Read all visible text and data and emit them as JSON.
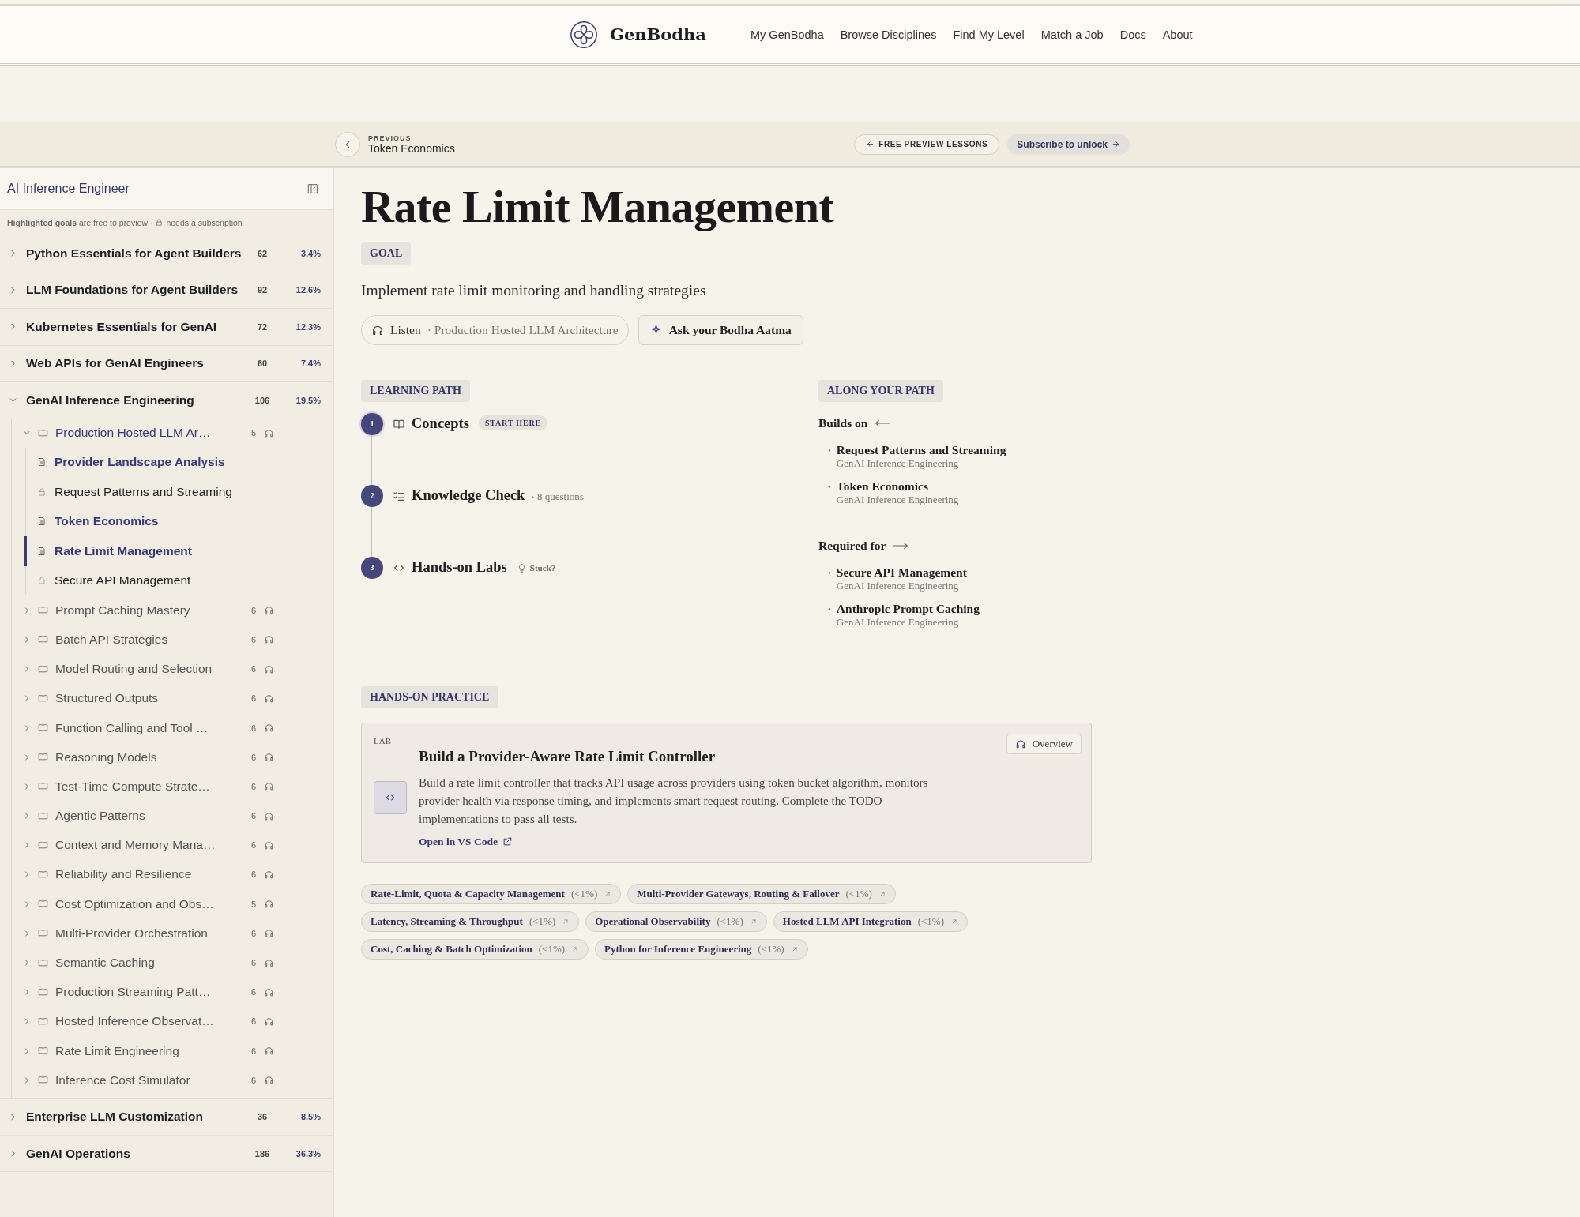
{
  "header": {
    "brand": "GenBodha",
    "nav": [
      {
        "label": "My GenBodha"
      },
      {
        "label": "Browse Disciplines"
      },
      {
        "label": "Find My Level"
      },
      {
        "label": "Match a Job"
      },
      {
        "label": "Docs"
      },
      {
        "label": "About"
      }
    ]
  },
  "nav_bar": {
    "previous_label": "PREVIOUS",
    "previous_title": "Token Economics",
    "preview_button": "FREE PREVIEW LESSONS",
    "subscribe_button": "Subscribe to unlock"
  },
  "sidebar": {
    "title": "AI Inference Engineer",
    "legend": "**Highlighted goals** are free to preview ·",
    "legend_lock": "needs a subscription",
    "modules": [
      {
        "title": "Python Essentials for Agent Builders",
        "count": "62",
        "percent": "3.4%",
        "expanded": false
      },
      {
        "title": "LLM Foundations for Agent Builders",
        "count": "92",
        "percent": "12.6%",
        "expanded": false
      },
      {
        "title": "Kubernetes Essentials for GenAI",
        "count": "72",
        "percent": "12.3%",
        "expanded": false
      },
      {
        "title": "Web APIs for GenAI Engineers",
        "count": "60",
        "percent": "7.4%",
        "expanded": false
      },
      {
        "title": "GenAI Inference Engineering",
        "count": "106",
        "percent": "19.5%",
        "expanded": true,
        "children": [
          {
            "title": "Production Hosted LLM Ar…",
            "count": "5",
            "expanded": true,
            "children": [
              {
                "title": "Provider Landscape Analysis",
                "free": true,
                "selected": false
              },
              {
                "title": "Request Patterns and Streaming",
                "free": false,
                "selected": false
              },
              {
                "title": "Token Economics",
                "free": true,
                "selected": false
              },
              {
                "title": "Rate Limit Management",
                "free": true,
                "selected": true
              },
              {
                "title": "Secure API Management",
                "free": false,
                "selected": false
              }
            ]
          },
          {
            "title": "Prompt Caching Mastery",
            "count": "6",
            "expanded": false
          },
          {
            "title": "Batch API Strategies",
            "count": "6",
            "expanded": false
          },
          {
            "title": "Model Routing and Selection",
            "count": "6",
            "expanded": false
          },
          {
            "title": "Structured Outputs",
            "count": "6",
            "expanded": false
          },
          {
            "title": "Function Calling and Tool …",
            "count": "6",
            "expanded": false
          },
          {
            "title": "Reasoning Models",
            "count": "6",
            "expanded": false
          },
          {
            "title": "Test-Time Compute Strate…",
            "count": "6",
            "expanded": false
          },
          {
            "title": "Agentic Patterns",
            "count": "6",
            "expanded": false
          },
          {
            "title": "Context and Memory Mana…",
            "count": "6",
            "expanded": false
          },
          {
            "title": "Reliability and Resilience",
            "count": "6",
            "expanded": false
          },
          {
            "title": "Cost Optimization and Obs…",
            "count": "5",
            "expanded": false
          },
          {
            "title": "Multi-Provider Orchestration",
            "count": "6",
            "expanded": false
          },
          {
            "title": "Semantic Caching",
            "count": "6",
            "expanded": false
          },
          {
            "title": "Production Streaming Patt…",
            "count": "6",
            "expanded": false
          },
          {
            "title": "Hosted Inference Observat…",
            "count": "6",
            "expanded": false
          },
          {
            "title": "Rate Limit Engineering",
            "count": "6",
            "expanded": false
          },
          {
            "title": "Inference Cost Simulator",
            "count": "6",
            "expanded": false
          }
        ]
      },
      {
        "title": "Enterprise LLM Customization",
        "count": "36",
        "percent": "8.5%",
        "expanded": false
      },
      {
        "title": "GenAI Operations",
        "count": "186",
        "percent": "36.3%",
        "expanded": false
      }
    ]
  },
  "main": {
    "title": "Rate Limit Management",
    "badge": "GOAL",
    "description": "Implement rate limit monitoring and handling strategies",
    "listen_button": {
      "label": "Listen",
      "detail": "· Production Hosted LLM Architecture"
    },
    "ask_button": "Ask your Bodha Aatma",
    "learning_path": {
      "heading": "LEARNING PATH",
      "steps": [
        {
          "number": "1",
          "kind": "concepts",
          "title": "Concepts",
          "tag": "START HERE",
          "current": true
        },
        {
          "number": "2",
          "kind": "check",
          "title": "Knowledge Check",
          "note": "· 8 questions",
          "current": false
        },
        {
          "number": "3",
          "kind": "labs",
          "title": "Hands-on Labs",
          "hint": "Stuck?",
          "current": false
        }
      ]
    },
    "along_path": {
      "heading": "ALONG YOUR PATH",
      "sections": [
        {
          "kind": "back",
          "label": "Builds on",
          "items": [
            {
              "bullet": "•",
              "title": "Request Patterns and Streaming",
              "subtitle": "GenAI Inference Engineering"
            },
            {
              "bullet": "•",
              "title": "Token Economics",
              "subtitle": "GenAI Inference Engineering"
            }
          ]
        },
        {
          "kind": "forward",
          "label": "Required for",
          "items": [
            {
              "bullet": "•",
              "title": "Secure API Management",
              "subtitle": "GenAI Inference Engineering"
            },
            {
              "bullet": "•",
              "title": "Anthropic Prompt Caching",
              "subtitle": "GenAI Inference Engineering"
            }
          ]
        }
      ]
    },
    "practice": {
      "heading": "HANDS-ON PRACTICE",
      "lab": {
        "kind_label": "LAB",
        "overview_button": "Overview",
        "title": "Build a Provider-Aware Rate Limit Controller",
        "description": "Build a rate limit controller that tracks API usage across providers using token bucket algorithm, monitors provider health via response timing, and implements smart request routing. Complete the TODO implementations to pass all tests.",
        "link": "Open in VS Code"
      },
      "tags": [
        {
          "label": "Rate-Limit, Quota & Capacity Management",
          "share": "(<1%)"
        },
        {
          "label": "Multi-Provider Gateways, Routing & Failover",
          "share": "(<1%)"
        },
        {
          "label": "Latency, Streaming & Throughput",
          "share": "(<1%)"
        },
        {
          "label": "Operational Observability",
          "share": "(<1%)"
        },
        {
          "label": "Hosted LLM API Integration",
          "share": "(<1%)"
        },
        {
          "label": "Cost, Caching & Batch Optimization",
          "share": "(<1%)"
        },
        {
          "label": "Python for Inference Engineering",
          "share": "(<1%)"
        }
      ]
    }
  }
}
